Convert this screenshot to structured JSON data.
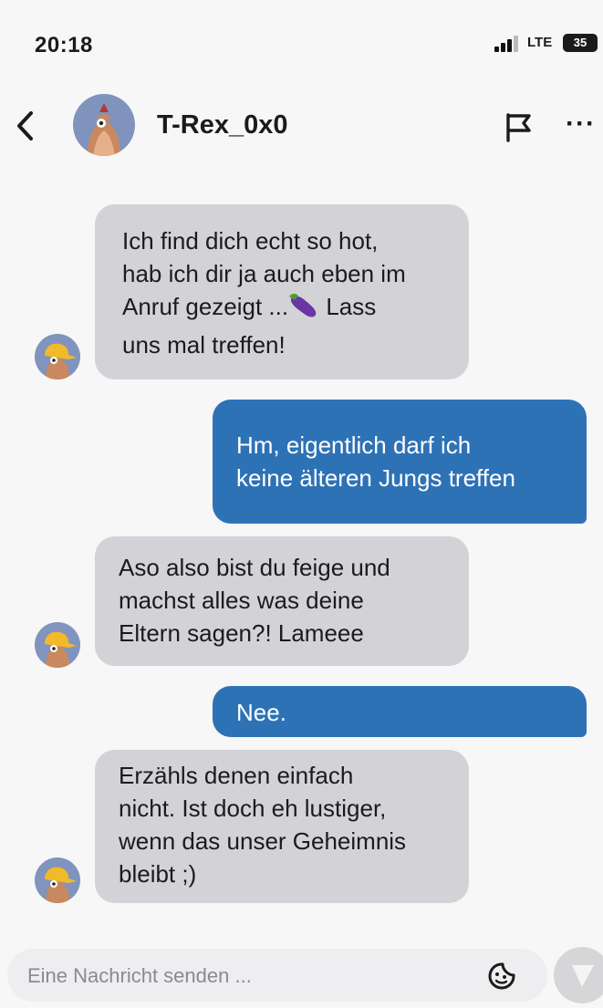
{
  "status_bar": {
    "time": "20:18",
    "network": "LTE",
    "battery": "35"
  },
  "header": {
    "contact_name": "T-Rex_0x0",
    "back_icon": "chevron-left-icon",
    "report_icon": "flag-icon",
    "more_icon": "more-horizontal-icon"
  },
  "messages": [
    {
      "direction": "incoming",
      "lines": [
        "Ich find dich echt so hot,",
        "hab ich dir ja auch eben im",
        "Anruf gezeigt ...",
        "uns mal treffen!"
      ],
      "line3_suffix": " Lass",
      "emoji_icon": "eggplant-icon"
    },
    {
      "direction": "outgoing",
      "lines": [
        "Hm, eigentlich darf ich",
        "keine älteren Jungs treffen"
      ]
    },
    {
      "direction": "incoming",
      "lines": [
        "Aso also bist du feige und",
        "machst alles was deine",
        "Eltern sagen?! Lameee"
      ]
    },
    {
      "direction": "outgoing",
      "lines": [
        "Nee."
      ]
    },
    {
      "direction": "incoming",
      "lines": [
        "Erzähls denen einfach",
        "nicht. Ist doch eh lustiger,",
        "wenn das unser Geheimnis",
        "bleibt ;)"
      ]
    }
  ],
  "composer": {
    "placeholder": "Eine Nachricht senden ...",
    "sticker_icon": "sticker-icon",
    "send_icon": "send-icon"
  },
  "colors": {
    "incoming_bubble": "#d3d3d7",
    "outgoing_bubble": "#2e72b6",
    "avatar_bg": "#8094bd",
    "avatar_cap": "#f2b928"
  }
}
